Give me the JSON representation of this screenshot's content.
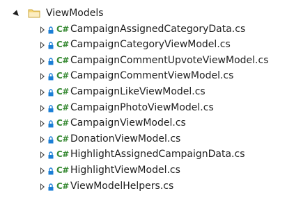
{
  "tree": {
    "folder": {
      "label": "ViewModels",
      "expanded": true,
      "icon": "folder-icon"
    },
    "file_icon_text": "C#",
    "file_icon_color": "#388a34",
    "lock_icon_color": "#1b7fd6",
    "items": [
      {
        "label": "CampaignAssignedCategoryData.cs"
      },
      {
        "label": "CampaignCategoryViewModel.cs"
      },
      {
        "label": "CampaignCommentUpvoteViewModel.cs"
      },
      {
        "label": "CampaignCommentViewModel.cs"
      },
      {
        "label": "CampaignLikeViewModel.cs"
      },
      {
        "label": "CampaignPhotoViewModel.cs"
      },
      {
        "label": "CampaignViewModel.cs"
      },
      {
        "label": "DonationViewModel.cs"
      },
      {
        "label": "HighlightAssignedCampaignData.cs"
      },
      {
        "label": "HighlightViewModel.cs"
      },
      {
        "label": "ViewModelHelpers.cs"
      }
    ]
  }
}
